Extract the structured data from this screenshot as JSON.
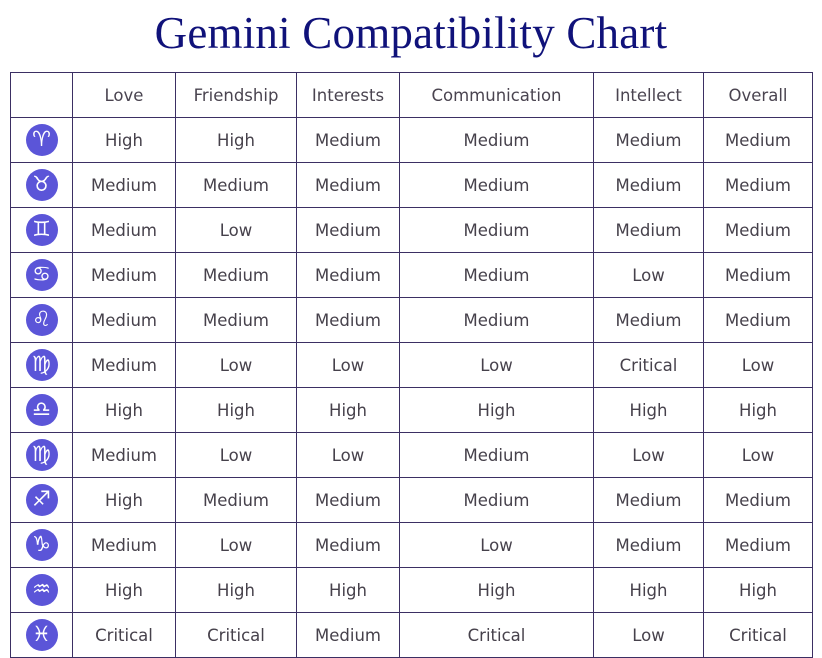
{
  "title": "Gemini Compatibility Chart",
  "colors": {
    "title": "#10127a",
    "border": "#3b2f63",
    "badge_bg": "#5b55d8",
    "badge_glyph": "#ffffff",
    "cell_text": "#46414b",
    "page_bg": "#ffffff"
  },
  "chart_data": {
    "type": "table",
    "title": "Gemini Compatibility Chart",
    "row_header_label": "",
    "categories": [
      "Love",
      "Friendship",
      "Interests",
      "Communication",
      "Intellect",
      "Overall"
    ],
    "rows": [
      {
        "sign": "Aries",
        "glyph": "♈",
        "icon_name": "aries-icon",
        "values": [
          "High",
          "High",
          "Medium",
          "Medium",
          "Medium",
          "Medium"
        ]
      },
      {
        "sign": "Taurus",
        "glyph": "♉",
        "icon_name": "taurus-icon",
        "values": [
          "Medium",
          "Medium",
          "Medium",
          "Medium",
          "Medium",
          "Medium"
        ]
      },
      {
        "sign": "Gemini",
        "glyph": "♊",
        "icon_name": "gemini-icon",
        "values": [
          "Medium",
          "Low",
          "Medium",
          "Medium",
          "Medium",
          "Medium"
        ]
      },
      {
        "sign": "Cancer",
        "glyph": "♋",
        "icon_name": "cancer-icon",
        "values": [
          "Medium",
          "Medium",
          "Medium",
          "Medium",
          "Low",
          "Medium"
        ]
      },
      {
        "sign": "Leo",
        "glyph": "♌",
        "icon_name": "leo-icon",
        "values": [
          "Medium",
          "Medium",
          "Medium",
          "Medium",
          "Medium",
          "Medium"
        ]
      },
      {
        "sign": "Virgo",
        "glyph": "♍",
        "icon_name": "virgo-icon",
        "values": [
          "Medium",
          "Low",
          "Low",
          "Low",
          "Critical",
          "Low"
        ]
      },
      {
        "sign": "Libra",
        "glyph": "♎",
        "icon_name": "libra-icon",
        "values": [
          "High",
          "High",
          "High",
          "High",
          "High",
          "High"
        ]
      },
      {
        "sign": "Scorpio",
        "glyph": "♍",
        "icon_name": "scorpio-icon",
        "values": [
          "Medium",
          "Low",
          "Low",
          "Medium",
          "Low",
          "Low"
        ]
      },
      {
        "sign": "Sagittarius",
        "glyph": "♐",
        "icon_name": "sagittarius-icon",
        "values": [
          "High",
          "Medium",
          "Medium",
          "Medium",
          "Medium",
          "Medium"
        ]
      },
      {
        "sign": "Capricorn",
        "glyph": "♑",
        "icon_name": "capricorn-icon",
        "values": [
          "Medium",
          "Low",
          "Medium",
          "Low",
          "Medium",
          "Medium"
        ]
      },
      {
        "sign": "Aquarius",
        "glyph": "♒",
        "icon_name": "aquarius-icon",
        "values": [
          "High",
          "High",
          "High",
          "High",
          "High",
          "High"
        ]
      },
      {
        "sign": "Pisces",
        "glyph": "♓",
        "icon_name": "pisces-icon",
        "values": [
          "Critical",
          "Critical",
          "Medium",
          "Critical",
          "Low",
          "Critical"
        ]
      }
    ]
  }
}
